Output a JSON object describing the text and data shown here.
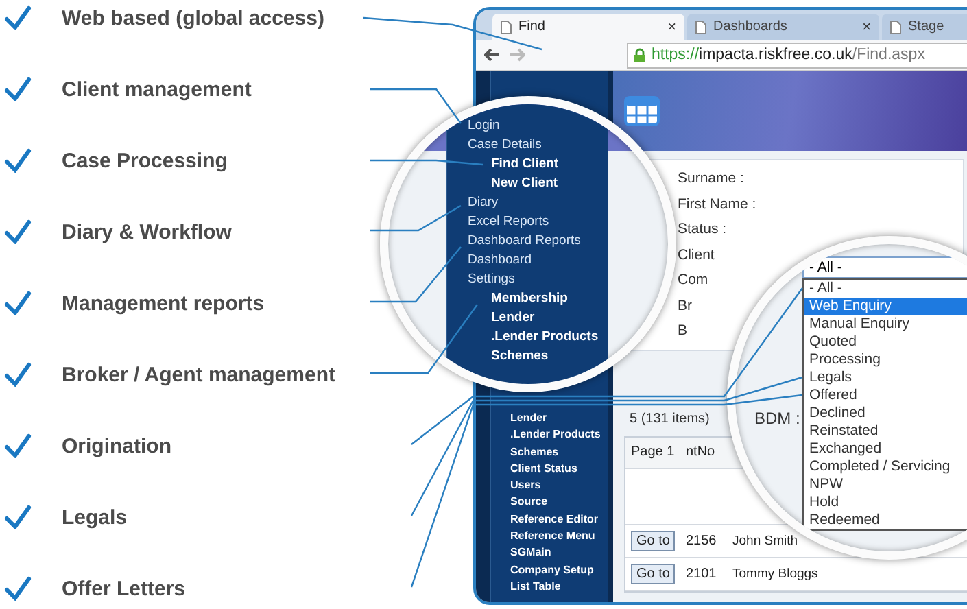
{
  "features": [
    "Web based (global access)",
    "Client management",
    "Case Processing",
    "Diary & Workflow",
    "Management reports",
    "Broker / Agent management",
    "Origination",
    "Legals",
    "Offer Letters"
  ],
  "browser": {
    "tabs": [
      {
        "title": "Find",
        "close": "×",
        "selected": true
      },
      {
        "title": "Dashboards",
        "close": "×",
        "selected": false
      },
      {
        "title": "Stage",
        "selected": false
      }
    ],
    "url": {
      "scheme": "https://",
      "host": "impacta.riskfree.co.uk",
      "path": "/Find.aspx"
    }
  },
  "magnified_menu": [
    {
      "label": "Login"
    },
    {
      "label": "Case Details",
      "children": [
        {
          "label": "Find Client"
        },
        {
          "label": "New Client"
        }
      ]
    },
    {
      "label": "Diary"
    },
    {
      "label": "Excel Reports"
    },
    {
      "label": "Dashboard Reports"
    },
    {
      "label": "Dashboard"
    },
    {
      "label": "Settings",
      "children": [
        {
          "label": "Membership"
        },
        {
          "label": "Lender"
        },
        {
          "label": ".Lender Products"
        },
        {
          "label": "Schemes"
        }
      ]
    }
  ],
  "sidebar_items": [
    "Lender",
    ".Lender Products",
    "Schemes",
    "Client Status",
    "Users",
    "Source",
    "Reference Editor",
    "Reference Menu",
    "SGMain",
    "Company Setup",
    "List Table"
  ],
  "form": {
    "labels": [
      "Surname :",
      "First Name :",
      "Status :",
      "Client",
      "Com",
      "Br",
      "B"
    ],
    "bdm_label": "BDM :",
    "select_value": "- All -",
    "options": [
      {
        "label": "- All -",
        "selected": false
      },
      {
        "label": "Web Enquiry",
        "selected": true
      },
      {
        "label": "Manual Enquiry",
        "selected": false
      },
      {
        "label": "Quoted",
        "selected": false
      },
      {
        "label": "Processing",
        "selected": false
      },
      {
        "label": "Legals",
        "selected": false
      },
      {
        "label": "Offered",
        "selected": false
      },
      {
        "label": "Declined",
        "selected": false
      },
      {
        "label": "Reinstated",
        "selected": false
      },
      {
        "label": "Exchanged",
        "selected": false
      },
      {
        "label": "Completed / Servicing",
        "selected": false
      },
      {
        "label": "NPW",
        "selected": false
      },
      {
        "label": "Hold",
        "selected": false
      },
      {
        "label": "Redeemed",
        "selected": false
      }
    ]
  },
  "results": {
    "summary": "5 (131 items)",
    "columns": [
      "Page 1",
      "ntNo"
    ],
    "rows": [
      {
        "button": "Go to",
        "number": "2156",
        "name": "John Smith"
      },
      {
        "button": "Go to",
        "number": "2101",
        "name": "Tommy Bloggs"
      }
    ]
  }
}
